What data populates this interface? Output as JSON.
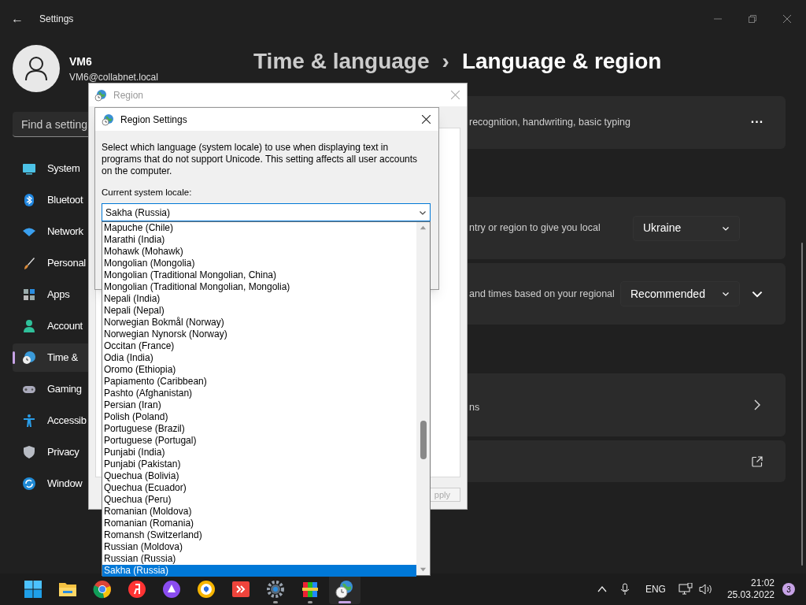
{
  "window": {
    "title": "Settings",
    "back": "←"
  },
  "user": {
    "name": "VM6",
    "email": "VM6@collabnet.local"
  },
  "search": {
    "placeholder": "Find a setting"
  },
  "sidebar": {
    "items": [
      {
        "label": "System",
        "selected": false
      },
      {
        "label": "Bluetoot",
        "selected": false
      },
      {
        "label": "Network",
        "selected": false
      },
      {
        "label": "Personal",
        "selected": false
      },
      {
        "label": "Apps",
        "selected": false
      },
      {
        "label": "Account",
        "selected": false
      },
      {
        "label": "Time &",
        "selected": true
      },
      {
        "label": "Gaming",
        "selected": false
      },
      {
        "label": "Accessib",
        "selected": false
      },
      {
        "label": "Privacy",
        "selected": false
      },
      {
        "label": "Window",
        "selected": false
      }
    ]
  },
  "breadcrumb": {
    "parent": "Time & language",
    "separator": "›",
    "current": "Language & region"
  },
  "cards": [
    {
      "kind": "more",
      "text": "recognition, handwriting, basic typing",
      "action": "..."
    },
    {
      "kind": "select",
      "text": "ntry or region to give you local",
      "value": "Ukraine"
    },
    {
      "kind": "select-expand",
      "text": "and times based on your regional",
      "value": "Recommended"
    },
    {
      "kind": "link",
      "text": "ns"
    },
    {
      "kind": "external"
    }
  ],
  "region_dialog": {
    "title": "Region",
    "apply": "pply"
  },
  "region_settings": {
    "title": "Region Settings",
    "description": "Select which language (system locale) to use when displaying text in programs that do not support Unicode. This setting affects all user accounts on the computer.",
    "locale_label": "Current system locale:",
    "locale_value": "Sakha (Russia)",
    "options": [
      {
        "label": "Mapuche (Chile)",
        "selected": false
      },
      {
        "label": "Marathi (India)",
        "selected": false
      },
      {
        "label": "Mohawk (Mohawk)",
        "selected": false
      },
      {
        "label": "Mongolian (Mongolia)",
        "selected": false
      },
      {
        "label": "Mongolian (Traditional Mongolian, China)",
        "selected": false
      },
      {
        "label": "Mongolian (Traditional Mongolian, Mongolia)",
        "selected": false
      },
      {
        "label": "Nepali (India)",
        "selected": false
      },
      {
        "label": "Nepali (Nepal)",
        "selected": false
      },
      {
        "label": "Norwegian Bokmål (Norway)",
        "selected": false
      },
      {
        "label": "Norwegian Nynorsk (Norway)",
        "selected": false
      },
      {
        "label": "Occitan (France)",
        "selected": false
      },
      {
        "label": "Odia (India)",
        "selected": false
      },
      {
        "label": "Oromo (Ethiopia)",
        "selected": false
      },
      {
        "label": "Papiamento (Caribbean)",
        "selected": false
      },
      {
        "label": "Pashto (Afghanistan)",
        "selected": false
      },
      {
        "label": "Persian (Iran)",
        "selected": false
      },
      {
        "label": "Polish (Poland)",
        "selected": false
      },
      {
        "label": "Portuguese (Brazil)",
        "selected": false
      },
      {
        "label": "Portuguese (Portugal)",
        "selected": false
      },
      {
        "label": "Punjabi (India)",
        "selected": false
      },
      {
        "label": "Punjabi (Pakistan)",
        "selected": false
      },
      {
        "label": "Quechua (Bolivia)",
        "selected": false
      },
      {
        "label": "Quechua (Ecuador)",
        "selected": false
      },
      {
        "label": "Quechua (Peru)",
        "selected": false
      },
      {
        "label": "Romanian (Moldova)",
        "selected": false
      },
      {
        "label": "Romanian (Romania)",
        "selected": false
      },
      {
        "label": "Romansh (Switzerland)",
        "selected": false
      },
      {
        "label": "Russian (Moldova)",
        "selected": false
      },
      {
        "label": "Russian (Russia)",
        "selected": false
      },
      {
        "label": "Sakha (Russia)",
        "selected": true
      }
    ]
  },
  "taskbar": {
    "apps": [
      {
        "running": false,
        "selected": false
      },
      {
        "running": false,
        "selected": false
      },
      {
        "running": false,
        "selected": false
      },
      {
        "running": false,
        "selected": false
      },
      {
        "running": false,
        "selected": false
      },
      {
        "running": false,
        "selected": false
      },
      {
        "running": false,
        "selected": false
      },
      {
        "running": true,
        "selected": false
      },
      {
        "running": true,
        "selected": false
      },
      {
        "running": true,
        "selected": true
      }
    ],
    "language": "ENG",
    "time": "21:02",
    "date": "25.03.2022",
    "notifications": "3"
  }
}
